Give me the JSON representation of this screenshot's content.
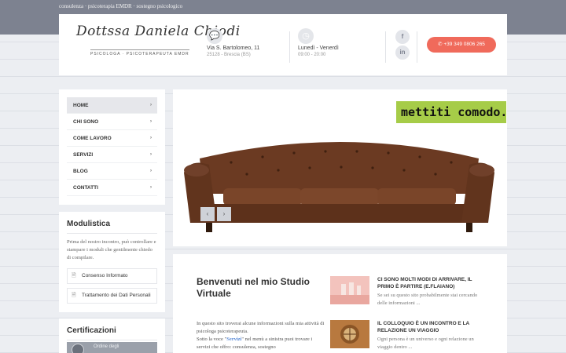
{
  "topbar": {
    "tagline": "consulenza · psicoterapia EMDR · sostegno psicologico"
  },
  "header": {
    "logo_name": "Dottssa Daniela Chiodi",
    "logo_subtitle": "PSICOLOGA · PSICOTERAPEUTA EMDR",
    "address": {
      "title": "Via S. Bartolomeo, 11",
      "sub": "25128 - Brescia (BS)",
      "icon": "speech-bubble-icon"
    },
    "hours": {
      "title": "Lunedì - Venerdì",
      "sub": "09:00 - 20:00",
      "icon": "clock-icon"
    },
    "social": [
      {
        "label": "f",
        "icon": "facebook-icon"
      },
      {
        "label": "in",
        "icon": "linkedin-icon"
      }
    ],
    "phone": "+39 349 0806 265"
  },
  "nav": {
    "items": [
      {
        "label": "HOME",
        "active": true
      },
      {
        "label": "CHI SONO"
      },
      {
        "label": "COME LAVORO"
      },
      {
        "label": "SERVIZI"
      },
      {
        "label": "BLOG"
      },
      {
        "label": "CONTATTI"
      }
    ],
    "arrow": "›"
  },
  "modulistica": {
    "title": "Modulistica",
    "text": "Prima del nostro incontro, può controllare e stampare i moduli che gentilmente chiedo di compilare.",
    "docs": [
      {
        "label": "Consenso Informato"
      },
      {
        "label": "Trattamento dei Dati Personali"
      }
    ]
  },
  "certificazioni": {
    "title": "Certificazioni",
    "badge_label": "Ordine degli"
  },
  "slider": {
    "tagline": "mettiti comodo..",
    "prev": "‹",
    "next": "›"
  },
  "content": {
    "welcome_title": "Benvenuti nel mio Studio Virtuale",
    "body_line1": "In questo sito troverai alcune informazioni sulla mia attività di psicologa psicoterapeuta.",
    "body_pre": "Sotto la voce \"",
    "body_link": "Servizi",
    "body_post": "\" nel menù a sinistra puoi trovare i servizi che offro: consulenza, sostegno",
    "posts": [
      {
        "title": "CI SONO MOLTI MODI DI ARRIVARE, IL PRIMO È PARTIRE (E.FLAIANO)",
        "excerpt": "Se sei su questo sito probabilmente stai cercando delle informazioni ..."
      },
      {
        "title": "IL COLLOQUIO È UN INCONTRO E LA RELAZIONE UN VIAGGIO",
        "excerpt": "Ogni persona è un universo e ogni relazione un viaggio dentro ..."
      }
    ]
  },
  "colors": {
    "accent": "#f06a5b",
    "topbar": "#7d8290",
    "tag_green": "#a6cc48",
    "sofa": "#6b3a22"
  }
}
